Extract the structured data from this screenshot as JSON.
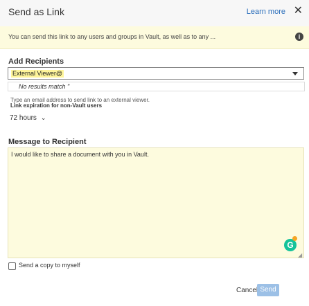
{
  "header": {
    "title": "Send as Link",
    "learn_more": "Learn more",
    "close_glyph": "✕"
  },
  "notice": {
    "text": "You can send this link to any users and groups in Vault, as well as to any ...",
    "icon": "info-icon"
  },
  "recipients": {
    "label": "Add Recipients",
    "value": "External Viewer@",
    "dropdown_no_results": "No results match \"",
    "hint": "Type an email address to send link to an external viewer.",
    "expiration_label": "Link expiration for non-Vault users",
    "expiration_value": "72 hours"
  },
  "message": {
    "label": "Message to Recipient",
    "text": "I would like to share a document with you in Vault."
  },
  "copy_myself": {
    "label": "Send a copy to myself",
    "checked": false
  },
  "footer": {
    "cancel": "Cancel",
    "send": "Send"
  },
  "colors": {
    "accent": "#2a6ebb",
    "notice_bg": "#fdfbde",
    "send_disabled": "#9cc0e6",
    "highlight": "#fff59a"
  }
}
